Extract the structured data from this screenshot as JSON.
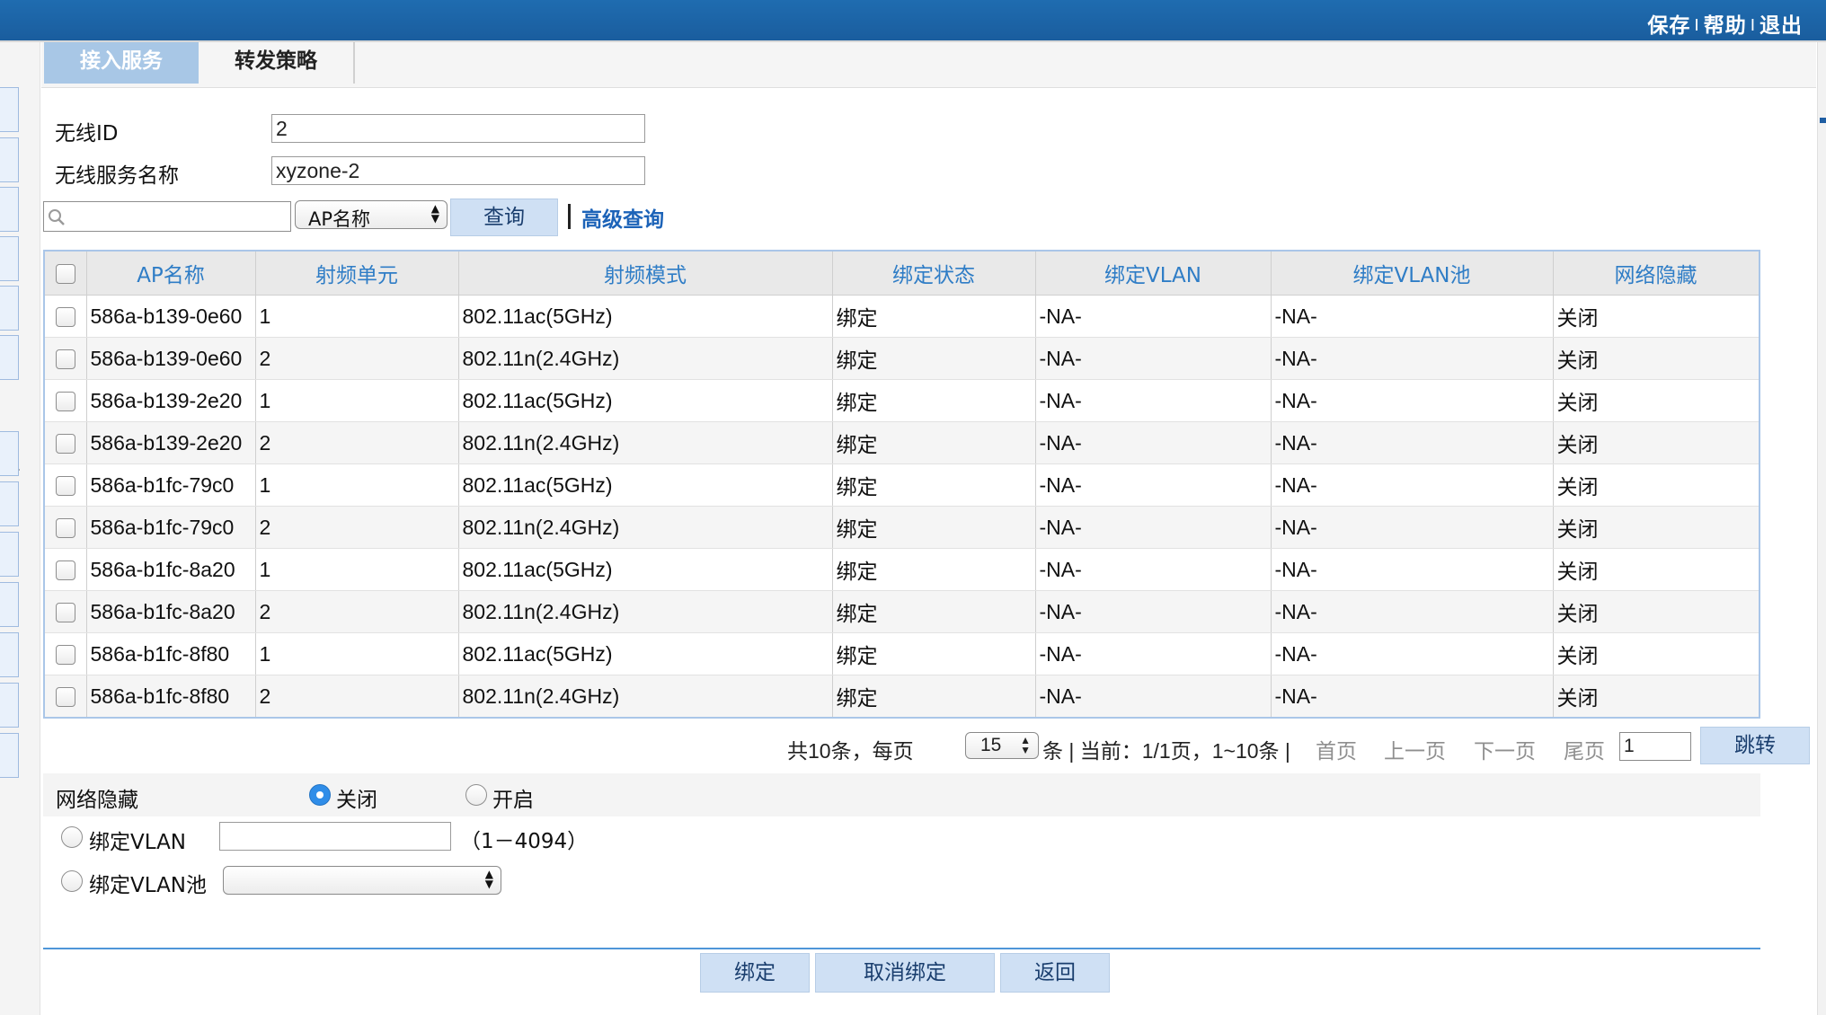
{
  "topbar": {
    "save": "保存",
    "help": "帮助",
    "logout": "退出",
    "separator": "I"
  },
  "tabs": [
    {
      "label": "接入服务",
      "active": true
    },
    {
      "label": "转发策略",
      "active": false
    }
  ],
  "form": {
    "wireless_id_label": "无线ID",
    "wireless_id_value": "2",
    "service_name_label": "无线服务名称",
    "service_name_value": "xyzone-2"
  },
  "search": {
    "input_value": "",
    "search_icon": "search-icon",
    "field_select": "AP名称",
    "query_button": "查询",
    "advanced_link": "高级查询"
  },
  "table": {
    "columns": [
      "AP名称",
      "射频单元",
      "射频模式",
      "绑定状态",
      "绑定VLAN",
      "绑定VLAN池",
      "网络隐藏"
    ],
    "rows": [
      {
        "ap": "586a-b139-0e60",
        "radio": "1",
        "mode": "802.11ac(5GHz)",
        "status": "绑定",
        "vlan": "-NA-",
        "vlan_pool": "-NA-",
        "hidden": "关闭"
      },
      {
        "ap": "586a-b139-0e60",
        "radio": "2",
        "mode": "802.11n(2.4GHz)",
        "status": "绑定",
        "vlan": "-NA-",
        "vlan_pool": "-NA-",
        "hidden": "关闭"
      },
      {
        "ap": "586a-b139-2e20",
        "radio": "1",
        "mode": "802.11ac(5GHz)",
        "status": "绑定",
        "vlan": "-NA-",
        "vlan_pool": "-NA-",
        "hidden": "关闭"
      },
      {
        "ap": "586a-b139-2e20",
        "radio": "2",
        "mode": "802.11n(2.4GHz)",
        "status": "绑定",
        "vlan": "-NA-",
        "vlan_pool": "-NA-",
        "hidden": "关闭"
      },
      {
        "ap": "586a-b1fc-79c0",
        "radio": "1",
        "mode": "802.11ac(5GHz)",
        "status": "绑定",
        "vlan": "-NA-",
        "vlan_pool": "-NA-",
        "hidden": "关闭"
      },
      {
        "ap": "586a-b1fc-79c0",
        "radio": "2",
        "mode": "802.11n(2.4GHz)",
        "status": "绑定",
        "vlan": "-NA-",
        "vlan_pool": "-NA-",
        "hidden": "关闭"
      },
      {
        "ap": "586a-b1fc-8a20",
        "radio": "1",
        "mode": "802.11ac(5GHz)",
        "status": "绑定",
        "vlan": "-NA-",
        "vlan_pool": "-NA-",
        "hidden": "关闭"
      },
      {
        "ap": "586a-b1fc-8a20",
        "radio": "2",
        "mode": "802.11n(2.4GHz)",
        "status": "绑定",
        "vlan": "-NA-",
        "vlan_pool": "-NA-",
        "hidden": "关闭"
      },
      {
        "ap": "586a-b1fc-8f80",
        "radio": "1",
        "mode": "802.11ac(5GHz)",
        "status": "绑定",
        "vlan": "-NA-",
        "vlan_pool": "-NA-",
        "hidden": "关闭"
      },
      {
        "ap": "586a-b1fc-8f80",
        "radio": "2",
        "mode": "802.11n(2.4GHz)",
        "status": "绑定",
        "vlan": "-NA-",
        "vlan_pool": "-NA-",
        "hidden": "关闭"
      }
    ]
  },
  "pagination": {
    "total_text": "共10条，每页",
    "page_size": "15",
    "per_page_suffix": "条 | 当前：1/1页，1~10条 |",
    "first": "首页",
    "prev": "上一页",
    "next": "下一页",
    "last": "尾页",
    "page_input": "1",
    "jump": "跳转"
  },
  "options": {
    "hide_label": "网络隐藏",
    "hide_off": "关闭",
    "hide_on": "开启",
    "hide_selected": "关闭",
    "vlan_label": "绑定VLAN",
    "vlan_value": "",
    "vlan_range": "（1－4094）",
    "vlan_pool_label": "绑定VLAN池",
    "vlan_pool_value": ""
  },
  "actions": {
    "bind": "绑定",
    "unbind": "取消绑定",
    "back": "返回"
  },
  "colors": {
    "topbar": "#1a5d9e",
    "accent": "#2f7dc6",
    "button_bg": "#cfe0f4",
    "tab_active": "#a8c7e6"
  }
}
